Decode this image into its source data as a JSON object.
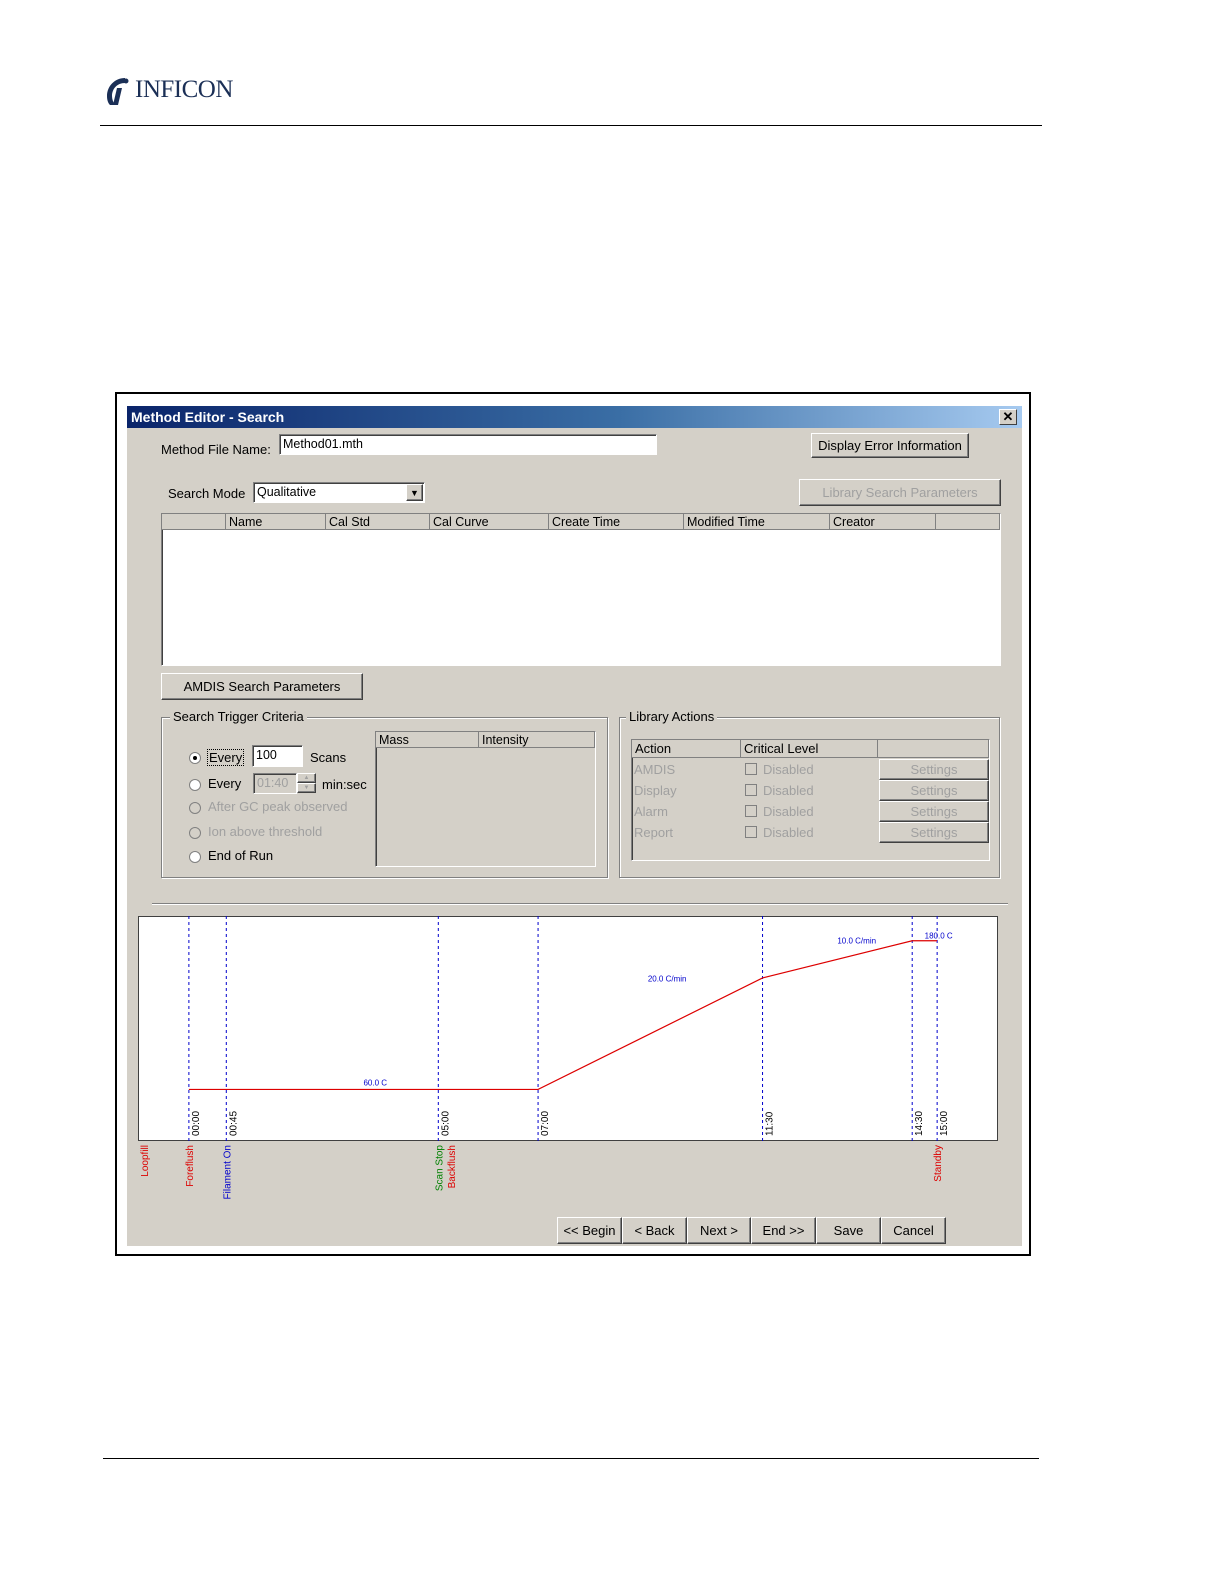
{
  "page": {
    "brand": "INFICON"
  },
  "window": {
    "title": "Method Editor - Search",
    "close_glyph": "✕",
    "method_file_label": "Method File Name:",
    "method_file_value": "Method01.mth",
    "display_error_button": "Display Error Information",
    "search_mode_label": "Search Mode",
    "search_mode_value": "Qualitative",
    "library_search_params_button": "Library Search Parameters",
    "table_columns": [
      "",
      "Name",
      "Cal Std",
      "Cal Curve",
      "Create Time",
      "Modified Time",
      "Creator",
      ""
    ],
    "amdis_button": "AMDIS Search Parameters",
    "trigger": {
      "title": "Search Trigger Criteria",
      "every_scans_label": "Every",
      "every_scans_value": "100",
      "scans_unit": "Scans",
      "every_time_label": "Every",
      "every_time_value": "01:40",
      "time_unit": "min:sec",
      "after_gc_label": "After GC peak observed",
      "ion_above_label": "Ion above threshold",
      "end_of_run_label": "End of Run",
      "mass_column": "Mass",
      "intensity_column": "Intensity"
    },
    "library_actions": {
      "title": "Library Actions",
      "col_action": "Action",
      "col_critical": "Critical Level",
      "rows": [
        {
          "action": "AMDIS",
          "level": "Disabled",
          "button": "Settings"
        },
        {
          "action": "Display",
          "level": "Disabled",
          "button": "Settings"
        },
        {
          "action": "Alarm",
          "level": "Disabled",
          "button": "Settings"
        },
        {
          "action": "Report",
          "level": "Disabled",
          "button": "Settings"
        }
      ]
    },
    "nav": {
      "begin": "<< Begin",
      "back": "< Back",
      "next": "Next >",
      "end": "End >>",
      "save": "Save",
      "cancel": "Cancel"
    }
  },
  "chart_data": {
    "type": "line",
    "x_range_min": [
      -1,
      16.2
    ],
    "y_range_c": [
      20,
      200
    ],
    "series": [
      {
        "x_min": [
          0,
          7,
          11.5,
          14.5,
          15
        ],
        "y_c": [
          60,
          60,
          150,
          180,
          180
        ]
      }
    ],
    "annotations": [
      {
        "text": "60.0 C",
        "x_min": 3.5,
        "y_c": 63
      },
      {
        "text": "20.0 C/min",
        "x_min": 9.2,
        "y_c": 147
      },
      {
        "text": "10.0 C/min",
        "x_min": 13.0,
        "y_c": 178
      },
      {
        "text": "180.0 C",
        "x_min": 14.75,
        "y_c": 182
      }
    ],
    "time_markers": [
      {
        "x_min": 0,
        "label": "00:00"
      },
      {
        "x_min": 0.75,
        "label": "00:45"
      },
      {
        "x_min": 5,
        "label": "05:00"
      },
      {
        "x_min": 7,
        "label": "07:00"
      },
      {
        "x_min": 11.5,
        "label": "11:30"
      },
      {
        "x_min": 14.5,
        "label": "14:30"
      },
      {
        "x_min": 15,
        "label": "15:00"
      }
    ],
    "events": [
      {
        "x_min": -0.9,
        "label": "Loopfill",
        "color": "#dd0000"
      },
      {
        "x_min": 0,
        "label": "Foreflush",
        "color": "#dd0000"
      },
      {
        "x_min": 0.75,
        "label": "Filament On",
        "color": "#0000cc"
      },
      {
        "x_min": 5,
        "label": "Scan Stop",
        "color": "#008000"
      },
      {
        "x_min": 5.25,
        "label": "Backflush",
        "color": "#dd0000"
      },
      {
        "x_min": 15,
        "label": "Standby",
        "color": "#dd0000"
      }
    ],
    "colors": {
      "curve": "#dd0000",
      "marker": "#0000cc",
      "annotation": "#0000cc"
    }
  }
}
